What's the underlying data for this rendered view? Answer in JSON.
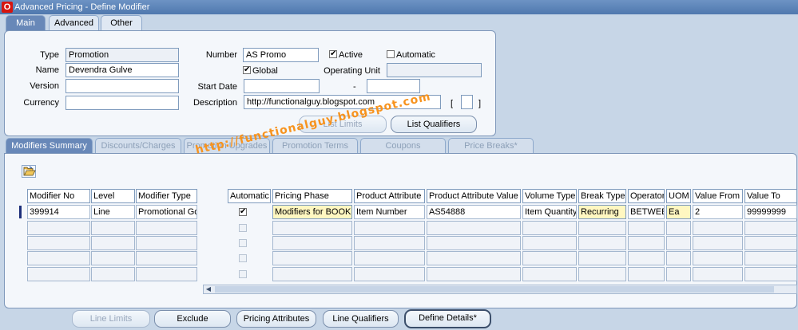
{
  "window": {
    "title": "Advanced Pricing - Define Modifier",
    "logo_letter": "O"
  },
  "header_tabs": [
    "Main",
    "Advanced",
    "Other"
  ],
  "header": {
    "type": {
      "label": "Type",
      "value": "Promotion"
    },
    "name": {
      "label": "Name",
      "value": "Devendra Gulve"
    },
    "version": {
      "label": "Version",
      "value": ""
    },
    "currency": {
      "label": "Currency",
      "value": ""
    },
    "number": {
      "label": "Number",
      "value": "AS Promo"
    },
    "active": {
      "label": "Active",
      "checked": true
    },
    "automatic": {
      "label": "Automatic",
      "checked": false
    },
    "global": {
      "label": "Global",
      "checked": true
    },
    "operating_unit": {
      "label": "Operating Unit",
      "value": ""
    },
    "start_date": {
      "label": "Start Date",
      "value": ""
    },
    "date_dash": "-",
    "end_date": {
      "value": ""
    },
    "description": {
      "label": "Description",
      "value": "http://functionalguy.blogspot.com"
    },
    "flex_open": "[",
    "flex_close": "]",
    "buttons": {
      "list_limits": "List Limits",
      "list_qualifiers": "List Qualifiers"
    }
  },
  "line_tabs": [
    "Modifiers Summary",
    "Discounts/Charges",
    "Promotion Upgrades",
    "Promotion Terms",
    "Coupons",
    "Price Breaks*"
  ],
  "watermark": "http://functionalguy.blogspot.com",
  "lines": {
    "columns": [
      "Modifier No",
      "Level",
      "Modifier Type",
      "Automatic",
      "Pricing Phase",
      "Product Attribute",
      "Product Attribute Value",
      "Volume Type",
      "Break Type",
      "Operator",
      "UOM",
      "Value From",
      "Value To"
    ],
    "rows": [
      {
        "modifier_no": "399914",
        "level": "Line",
        "modifier_type": "Promotional Go",
        "automatic": true,
        "pricing_phase": "Modifiers for BOOK",
        "product_attribute": "Item Number",
        "product_attribute_value": "AS54888",
        "volume_type": "Item Quantity",
        "break_type": "Recurring",
        "operator": "BETWEE",
        "uom": "Ea",
        "value_from": "2",
        "value_to": "99999999"
      }
    ]
  },
  "bottom_buttons": {
    "line_limits": "Line Limits",
    "exclude": "Exclude",
    "pricing_attributes": "Pricing Attributes",
    "line_qualifiers": "Line Qualifiers",
    "define_details": "Define Details*"
  },
  "colors": {
    "title_bar": "#5a84bb",
    "active_tab": "#6888b8",
    "highlight_field": "#fff7c1",
    "watermark": "#f7931e"
  }
}
